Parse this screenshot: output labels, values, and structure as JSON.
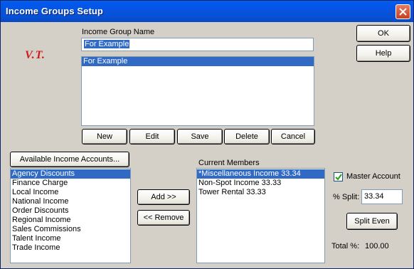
{
  "window": {
    "title": "Income Groups Setup"
  },
  "logo": {
    "text": "V.T."
  },
  "group": {
    "name_label": "Income Group Name",
    "name_value": "For Example",
    "list": [
      "For Example"
    ],
    "selected_index": 0
  },
  "group_buttons": {
    "new": "New",
    "edit": "Edit",
    "save": "Save",
    "delete": "Delete",
    "cancel": "Cancel"
  },
  "side_buttons": {
    "ok": "OK",
    "help": "Help"
  },
  "available": {
    "button_label": "Available Income Accounts...",
    "items": [
      "Agency Discounts",
      "Finance Charge",
      "Local Income",
      "National Income",
      "Order Discounts",
      "Regional Income",
      "Sales Commissions",
      "Talent Income",
      "Trade Income"
    ],
    "selected_index": 0
  },
  "transfer": {
    "add": "Add >>",
    "remove": "<< Remove"
  },
  "members": {
    "label": "Current Members",
    "items": [
      "*Miscellaneous Income 33.34",
      "Non-Spot Income 33.33",
      "Tower Rental 33.33"
    ],
    "selected_index": 0
  },
  "master": {
    "label": "Master Account",
    "checked": true
  },
  "split": {
    "label": "% Split:",
    "value": "33.34",
    "even_button": "Split Even"
  },
  "total": {
    "label": "Total %:",
    "value": "100.00"
  },
  "colors": {
    "title_bar": "#0553dd",
    "selection": "#316ac5",
    "logo": "#d01818",
    "dialog_bg": "#d4d0c8"
  }
}
